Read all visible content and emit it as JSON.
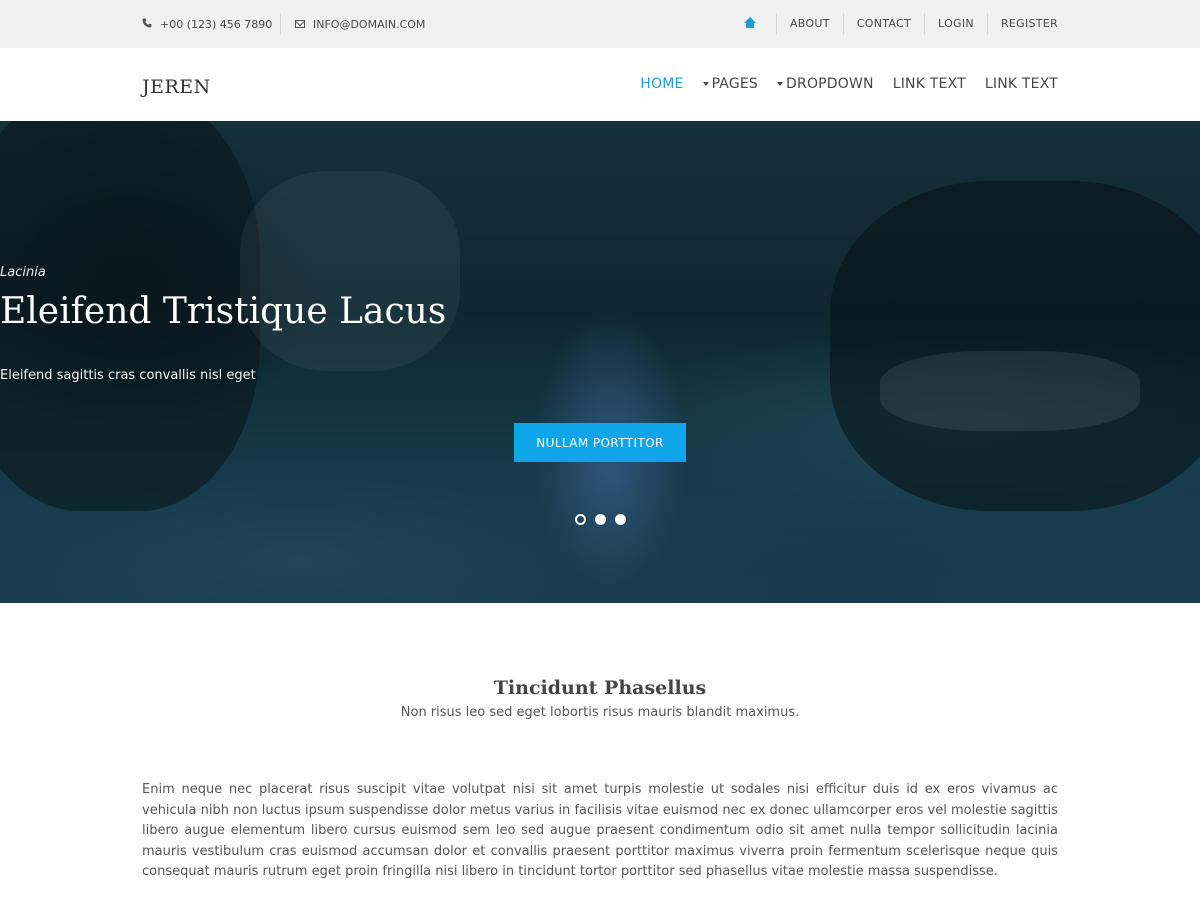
{
  "topbar": {
    "phone": "+00 (123) 456 7890",
    "email": "INFO@DOMAIN.COM",
    "links": [
      "ABOUT",
      "CONTACT",
      "LOGIN",
      "REGISTER"
    ],
    "home_icon": "home-icon"
  },
  "header": {
    "logo": "JEREN",
    "nav": {
      "home": "HOME",
      "pages": "PAGES",
      "dropdown": "DROPDOWN",
      "link1": "LINK TEXT",
      "link2": "LINK TEXT"
    }
  },
  "hero": {
    "kicker": "Lacinia",
    "title": "Eleifend Tristique Lacus",
    "subtitle": "Eleifend sagittis cras convallis nisl eget",
    "button": "NULLAM PORTTITOR",
    "slides": 3,
    "active_slide": 1
  },
  "intro": {
    "title": "Tincidunt Phasellus",
    "subtitle": "Non risus leo sed eget lobortis risus mauris blandit maximus.",
    "body": "Enim neque nec placerat risus suscipit vitae volutpat nisi sit amet turpis molestie ut sodales nisi efficitur duis id ex eros vivamus ac vehicula nibh non luctus ipsum suspendisse dolor metus varius in facilisis vitae euismod nec ex donec ullamcorper eros vel molestie sagittis libero augue elementum libero cursus euismod sem leo sed augue praesent condimentum odio sit amet nulla tempor sollicitudin lacinia mauris vestibulum cras euismod accumsan dolor et convallis praesent porttitor maximus viverra proin fermentum scelerisque neque quis consequat mauris rutrum eget proin fringilla nisi libero in tincidunt tortor porttitor sed phasellus vitae molestie massa suspendisse."
  },
  "colors": {
    "accent": "#1a9fd6",
    "button": "#0ea5e9",
    "topbar_bg": "#f0f0f0"
  }
}
